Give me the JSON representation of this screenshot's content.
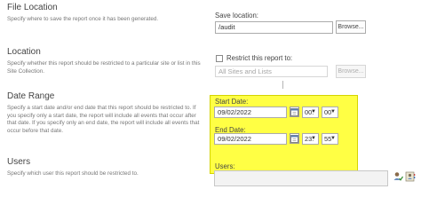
{
  "file_location": {
    "title": "File Location",
    "description": "Specify where to save the report once it has been generated.",
    "save_label": "Save location:",
    "save_value": "/audit",
    "browse_label": "Browse..."
  },
  "location": {
    "title": "Location",
    "description": "Specify whether this report should be restricted to a particular site or list in this Site Collection.",
    "restrict_label": "Restrict this report to:",
    "restrict_value": "All Sites and Lists",
    "browse_label": "Browse..."
  },
  "date_range": {
    "title": "Date Range",
    "description": "Specify a start date and/or end date that this report should be restricted to. If you specify only a start date, the report will include all events that occur after that date. If you specify only an end date, the report will include all events that occur before that date.",
    "start_label": "Start Date:",
    "start_date": "09/02/2022",
    "start_hour": "00:",
    "start_minute": "00",
    "end_label": "End Date:",
    "end_date": "09/02/2022",
    "end_hour": "23:",
    "end_minute": "55"
  },
  "users": {
    "title": "Users",
    "description": "Specify which user this report should be restricted to.",
    "users_label": "Users:",
    "users_value": ""
  },
  "icons": {
    "calendar": "calendar-icon",
    "dropdown": "chevron-down-icon",
    "check_names": "check-names-icon",
    "browse_people": "address-book-icon"
  },
  "colors": {
    "highlight": "#ffff44",
    "text": "#444444",
    "description": "#777777"
  }
}
